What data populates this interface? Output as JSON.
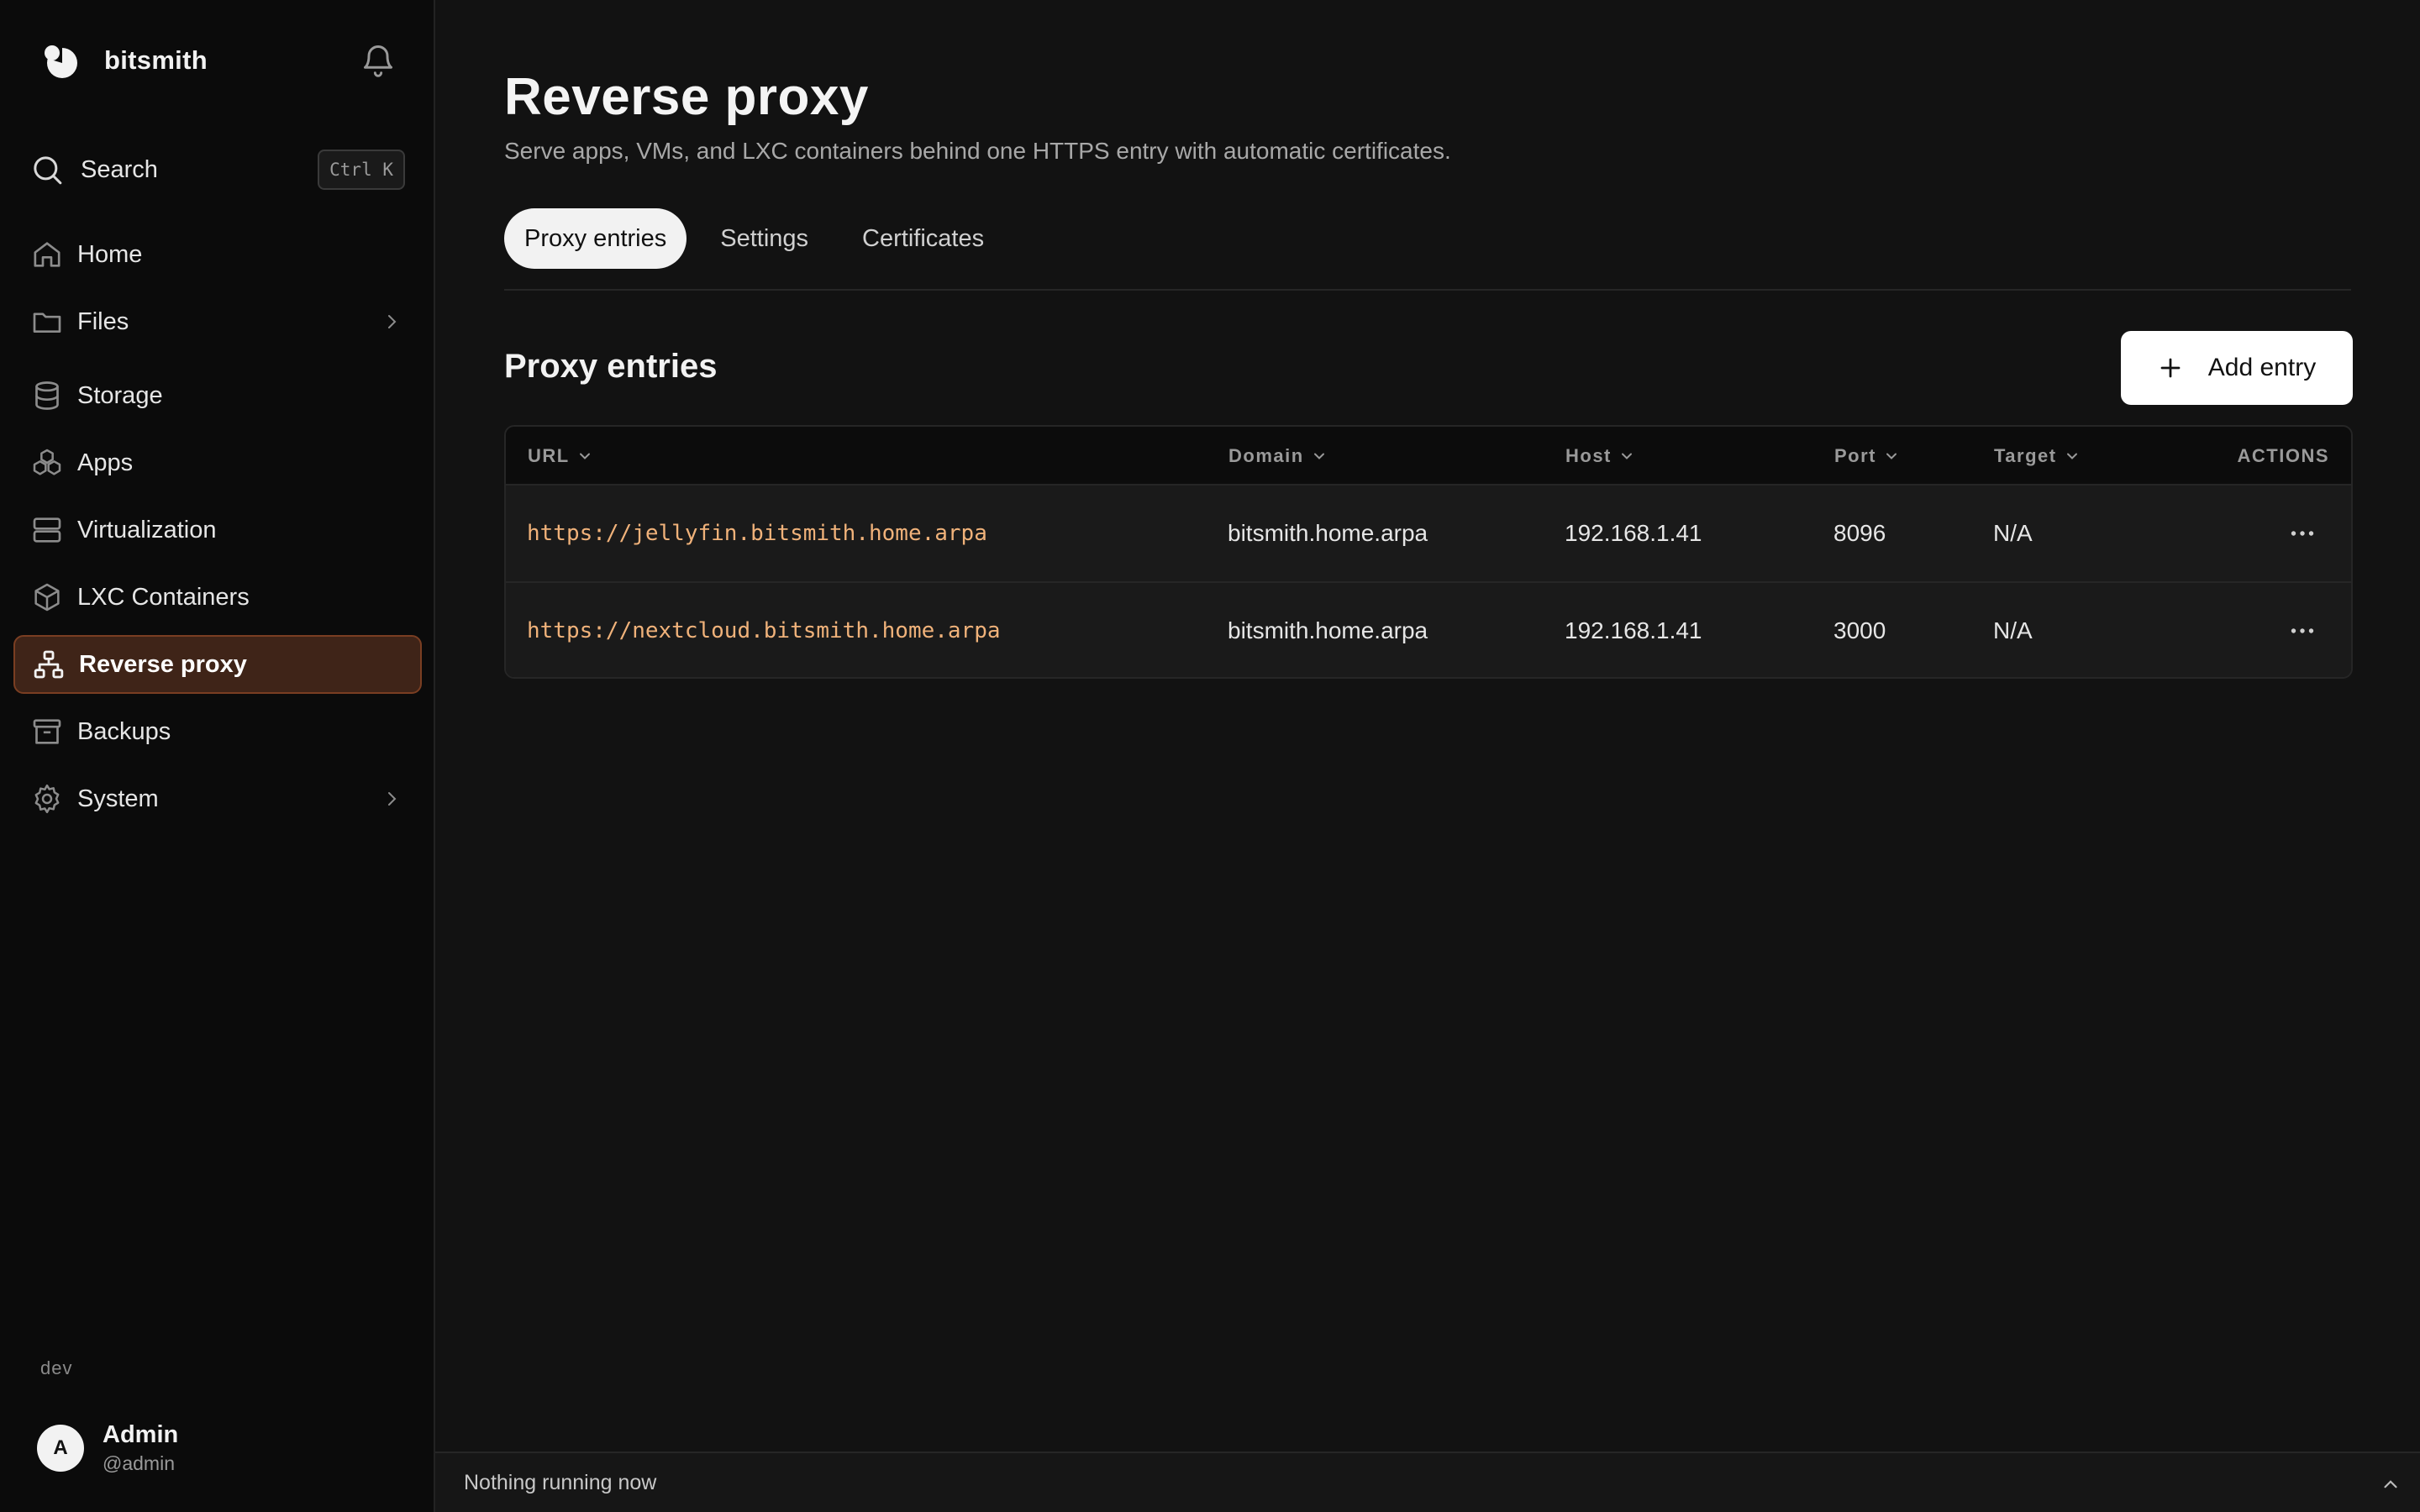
{
  "sidebar": {
    "brand": "bitsmith",
    "search": {
      "label": "Search",
      "shortcut": "Ctrl K"
    },
    "items": [
      {
        "label": "Home",
        "icon": "home-icon"
      },
      {
        "label": "Files",
        "icon": "folder-icon",
        "has_submenu": true
      },
      {
        "label": "Storage",
        "icon": "database-icon"
      },
      {
        "label": "Apps",
        "icon": "apps-icon"
      },
      {
        "label": "Virtualization",
        "icon": "server-icon"
      },
      {
        "label": "LXC Containers",
        "icon": "container-icon"
      },
      {
        "label": "Reverse proxy",
        "icon": "network-icon",
        "active": true
      },
      {
        "label": "Backups",
        "icon": "archive-icon"
      },
      {
        "label": "System",
        "icon": "gear-icon",
        "has_submenu": true
      }
    ],
    "env": "dev",
    "user": {
      "initial": "A",
      "name": "Admin",
      "handle": "@admin"
    }
  },
  "page": {
    "title": "Reverse proxy",
    "subtitle": "Serve apps, VMs, and LXC containers behind one HTTPS entry with automatic certificates.",
    "tabs": [
      {
        "label": "Proxy entries",
        "active": true
      },
      {
        "label": "Settings"
      },
      {
        "label": "Certificates"
      }
    ]
  },
  "section": {
    "title": "Proxy entries",
    "add_label": "Add entry"
  },
  "table": {
    "columns": [
      "URL",
      "Domain",
      "Host",
      "Port",
      "Target",
      "ACTIONS"
    ],
    "rows": [
      {
        "url": "https://jellyfin.bitsmith.home.arpa",
        "domain": "bitsmith.home.arpa",
        "host": "192.168.1.41",
        "port": "8096",
        "target": "N/A"
      },
      {
        "url": "https://nextcloud.bitsmith.home.arpa",
        "domain": "bitsmith.home.arpa",
        "host": "192.168.1.41",
        "port": "3000",
        "target": "N/A"
      }
    ]
  },
  "status": {
    "text": "Nothing running now"
  },
  "colors": {
    "accent": "#f0b27a",
    "active_nav_bg": "#3f2418",
    "active_nav_border": "#7a3e22"
  }
}
